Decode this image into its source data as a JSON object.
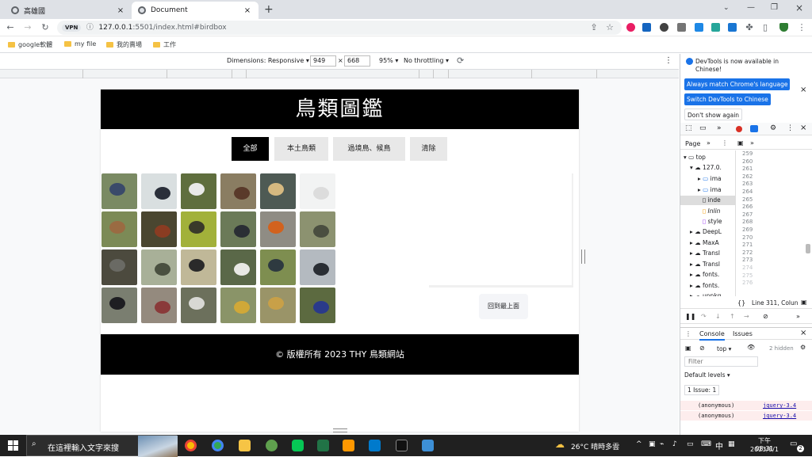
{
  "browser": {
    "tabs": [
      {
        "title": "高雄國",
        "active": false
      },
      {
        "title": "Document",
        "active": true
      }
    ],
    "new_tab": "+",
    "url_main": "127.0.0.1",
    "url_rest": ":5501/index.html#birdbox",
    "vpn": "VPN",
    "bookmarks": [
      "google軟體",
      "my file",
      "我的賣場",
      "工作"
    ]
  },
  "device_toolbar": {
    "dimensions_label": "Dimensions: Responsive ▾",
    "width": "949",
    "height": "668",
    "times": "×",
    "zoom": "95% ▾",
    "throttle": "No throttling ▾"
  },
  "site": {
    "title": "鳥類圖鑑",
    "filters": [
      "全部",
      "本土鳥類",
      "過境鳥、候鳥",
      "清除"
    ],
    "active_filter": 0,
    "back_to_top": "回到最上面",
    "footer": "© 版權所有 2023 THY 鳥類網站",
    "thumbs": [
      {
        "bg": "#7a8a63",
        "bird": "#3a4a6a"
      },
      {
        "bg": "#d9dfe0",
        "bird": "#2a2f3a"
      },
      {
        "bg": "#5f6e3e",
        "bird": "#e9e9e9"
      },
      {
        "bg": "#8a7d62",
        "bird": "#5a3a2a"
      },
      {
        "bg": "#4e5a54",
        "bird": "#d6b980"
      },
      {
        "bg": "#f2f3f3",
        "bird": "#dcdcdc"
      },
      {
        "bg": "#7c8a56",
        "bird": "#9a6b42"
      },
      {
        "bg": "#4a4630",
        "bird": "#8a3c22"
      },
      {
        "bg": "#a2b13a",
        "bird": "#3a3a2a"
      },
      {
        "bg": "#6b7a58",
        "bird": "#2a2e34"
      },
      {
        "bg": "#8f8c84",
        "bird": "#d2621e"
      },
      {
        "bg": "#8c9270",
        "bird": "#4a4e40"
      },
      {
        "bg": "#4c4a3e",
        "bird": "#6a6a64"
      },
      {
        "bg": "#a8b098",
        "bird": "#4a5040"
      },
      {
        "bg": "#c0b898",
        "bird": "#2a2a2a"
      },
      {
        "bg": "#5a6848",
        "bird": "#e8e8e4"
      },
      {
        "bg": "#7e8e50",
        "bird": "#2e3a40"
      },
      {
        "bg": "#b4bac0",
        "bird": "#2a2e34"
      },
      {
        "bg": "#7a7e70",
        "bird": "#1e1e22"
      },
      {
        "bg": "#948a7e",
        "bird": "#8a3a3a"
      },
      {
        "bg": "#6c705c",
        "bird": "#d8d8d4"
      },
      {
        "bg": "#8a9468",
        "bird": "#d0a838"
      },
      {
        "bg": "#9a9468",
        "bird": "#c8a048"
      },
      {
        "bg": "#5c6a40",
        "bird": "#2a3a8a"
      }
    ]
  },
  "devtools": {
    "notice": "DevTools is now available in Chinese!",
    "btn_match": "Always match Chrome's language",
    "btn_switch": "Switch DevTools to Chinese",
    "btn_dismiss": "Don't show again",
    "page_tab": "Page",
    "tree": [
      "top",
      "127.0.",
      "ima",
      "ima",
      "inde",
      "Inlin",
      "style",
      "DeepL",
      "MaxA",
      "Transl",
      "Transl",
      "fonts.",
      "fonts.",
      "unpkg"
    ],
    "line_numbers": [
      "259",
      "260",
      "261",
      "262",
      "263",
      "264",
      "265",
      "266",
      "267",
      "268",
      "269",
      "270",
      "271",
      "272",
      "273",
      "274",
      "275",
      "276"
    ],
    "cursor_pos": "Line 311, Colun",
    "console_tab": "Console",
    "issues_tab": "Issues",
    "context": "top ▾",
    "hidden": "2 hidden",
    "filter_placeholder": "Filter",
    "levels": "Default levels ▾",
    "issue_count": "1 Issue: 1",
    "log_rows": [
      {
        "fn": "(anonymous)",
        "src": "jquery-3.4"
      },
      {
        "fn": "(anonymous)",
        "src": "jquery-3.4"
      }
    ]
  },
  "taskbar": {
    "search_placeholder": "在這裡輸入文字來搜",
    "weather": "26°C 晴時多雲",
    "ime": "中",
    "time": "下午 08:31",
    "date": "2023/8/1",
    "notif": "2"
  }
}
